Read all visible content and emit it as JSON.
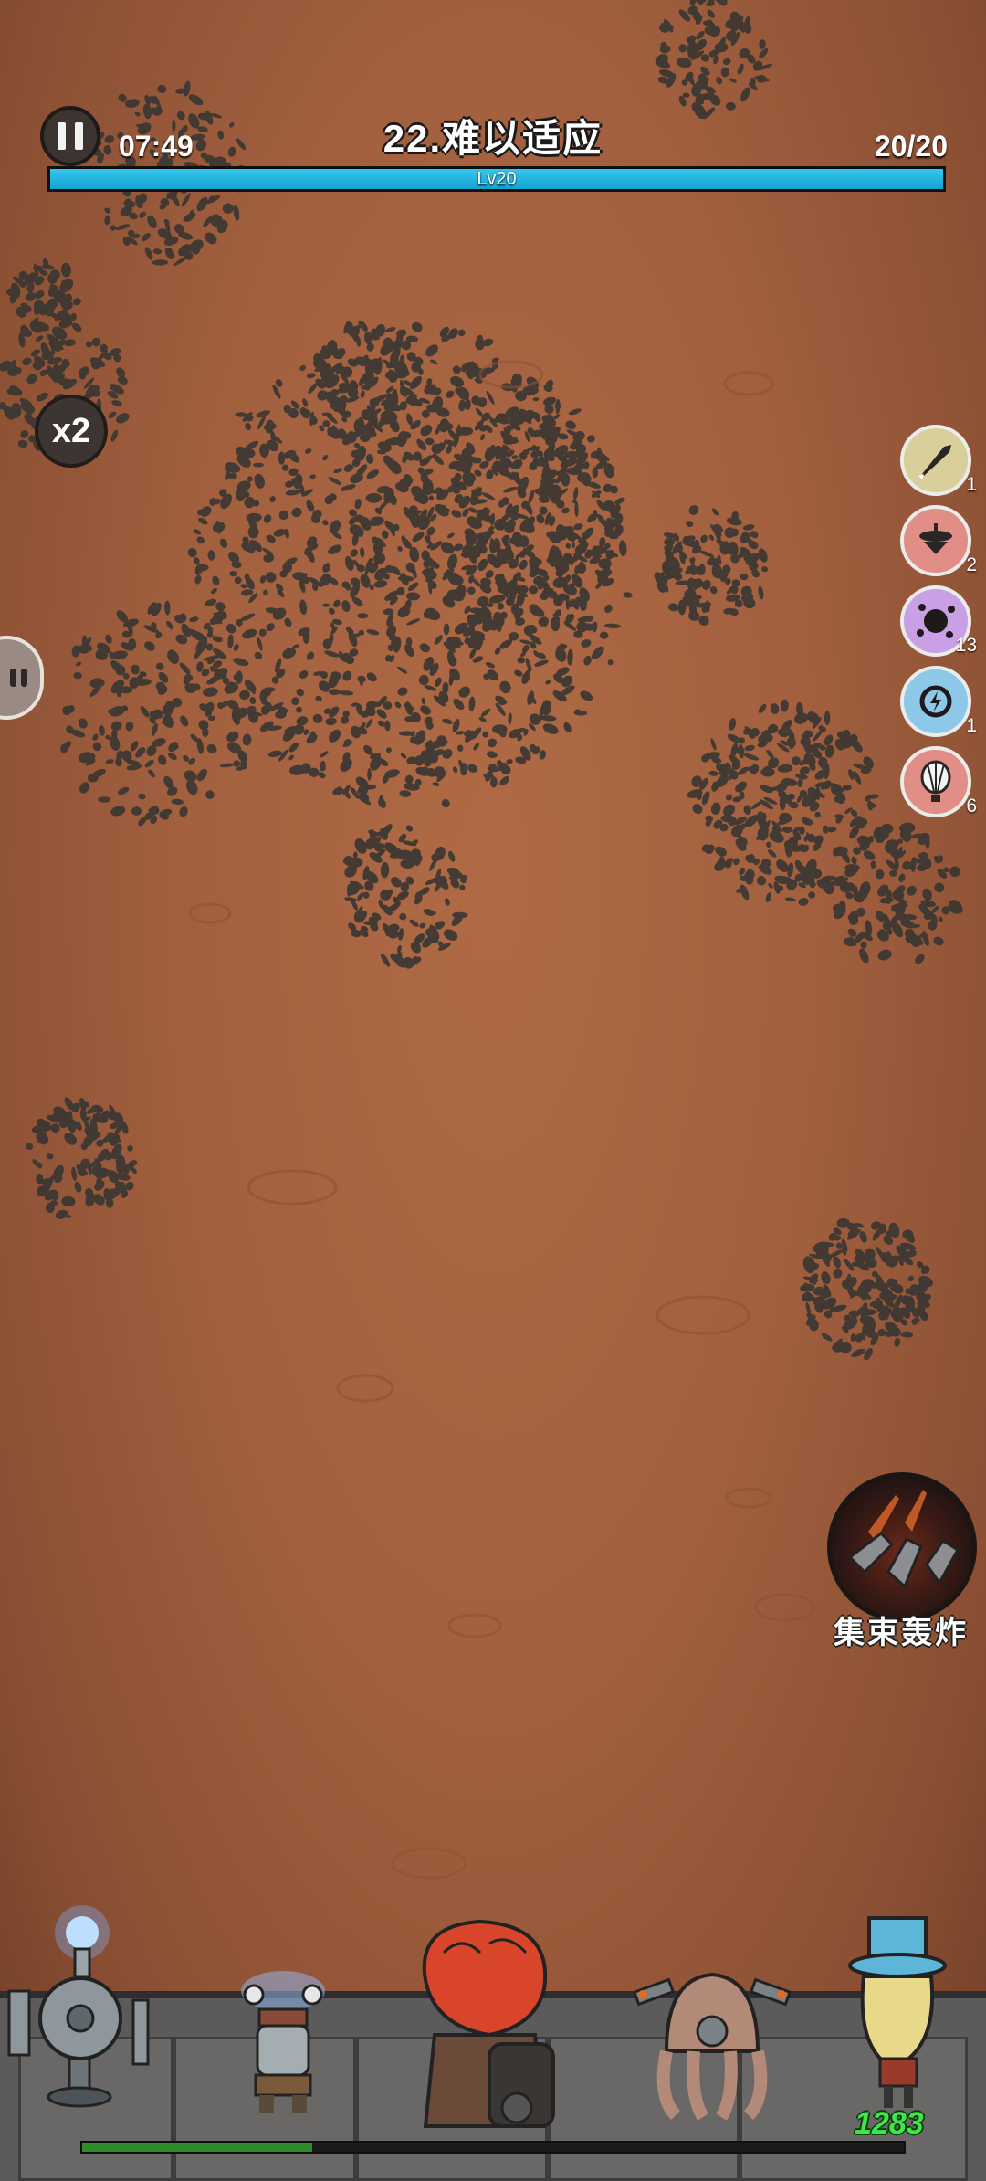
{
  "hud": {
    "time": "07:49",
    "stage_title": "22.难以适应",
    "wave": "20/20",
    "level_label": "Lv20",
    "xp_fraction": 1.0,
    "speed_label": "x2"
  },
  "skills": [
    {
      "icon": "rocket-bullet-icon",
      "count": "1",
      "color": "#d9cf9a"
    },
    {
      "icon": "drone-ufo-icon",
      "count": "2",
      "color": "#e08e86"
    },
    {
      "icon": "splat-bomb-icon",
      "count": "13",
      "color": "#c9a0e6"
    },
    {
      "icon": "lightning-ring-icon",
      "count": "1",
      "color": "#8ec8e8"
    },
    {
      "icon": "hot-air-balloon-icon",
      "count": "6",
      "color": "#e08e86"
    }
  ],
  "ultimate": {
    "label": "集束轰炸",
    "icon": "cluster-missile-icon"
  },
  "base": {
    "hp_fraction": 0.28,
    "gold": "1283"
  },
  "heroes": [
    "tesla-tower-hero",
    "electric-robot-hero",
    "red-hair-gunner-hero",
    "octopus-diver-hero",
    "top-hat-hero"
  ]
}
